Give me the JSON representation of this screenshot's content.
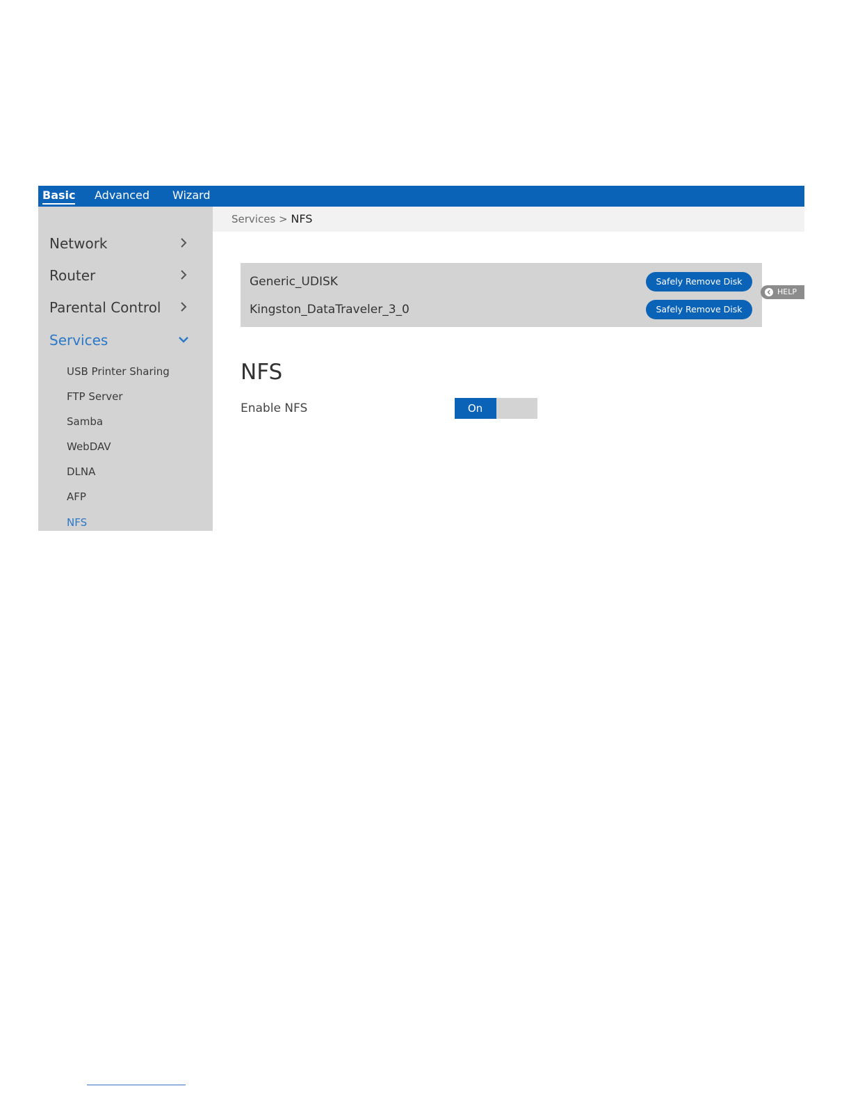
{
  "topnav": {
    "tabs": [
      {
        "label": "Basic",
        "active": true
      },
      {
        "label": "Advanced",
        "active": false
      },
      {
        "label": "Wizard",
        "active": false
      }
    ]
  },
  "sidebar": {
    "items": [
      {
        "label": "Network",
        "icon": "chevron-right-icon"
      },
      {
        "label": "Router",
        "icon": "chevron-right-icon"
      },
      {
        "label": "Parental Control",
        "icon": "chevron-right-icon"
      },
      {
        "label": "Services",
        "icon": "chevron-down-icon",
        "active": true
      }
    ],
    "sub_items": [
      {
        "label": "USB Printer Sharing"
      },
      {
        "label": "FTP Server"
      },
      {
        "label": "Samba"
      },
      {
        "label": "WebDAV"
      },
      {
        "label": "DLNA"
      },
      {
        "label": "AFP"
      },
      {
        "label": "NFS",
        "active": true
      }
    ]
  },
  "breadcrumb": {
    "parent": "Services",
    "separator": " > ",
    "current": "NFS"
  },
  "disks": [
    {
      "name": "Generic_UDISK",
      "button_label": "Safely Remove Disk"
    },
    {
      "name": "Kingston_DataTraveler_3_0",
      "button_label": "Safely Remove Disk"
    }
  ],
  "help": {
    "label": "HELP",
    "icon": "chevron-left-circle-icon"
  },
  "nfs": {
    "title": "NFS",
    "enable_label": "Enable NFS",
    "toggle_label": "On",
    "toggle_state": "on",
    "toggle_fill": 0.5
  },
  "colors": {
    "accent": "#0b63b8",
    "active_text": "#2a78c8",
    "sidebar_bg": "#d3d3d3"
  }
}
